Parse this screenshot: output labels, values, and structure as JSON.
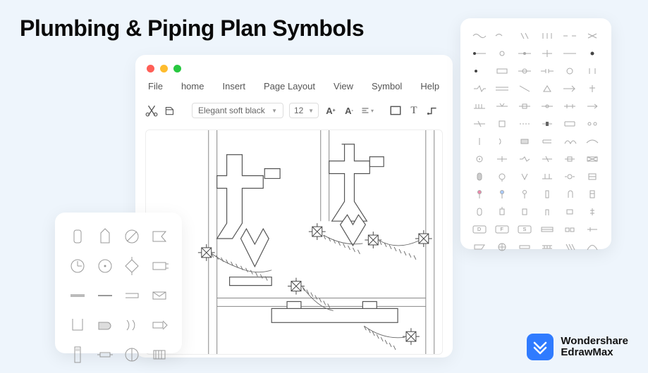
{
  "page_title": "Plumbing & Piping Plan Symbols",
  "menubar": {
    "file": "File",
    "home": "home",
    "insert": "Insert",
    "page_layout": "Page Layout",
    "view": "View",
    "symbol": "Symbol",
    "help": "Help"
  },
  "toolbar": {
    "font_name": "Elegant soft black",
    "font_size": "12",
    "increase_font": "A⁺",
    "decrease_font": "A⁻"
  },
  "right_panel_labels": {
    "d": "D",
    "f": "F",
    "s": "S"
  },
  "brand": {
    "line1": "Wondershare",
    "line2": "EdrawMax"
  }
}
